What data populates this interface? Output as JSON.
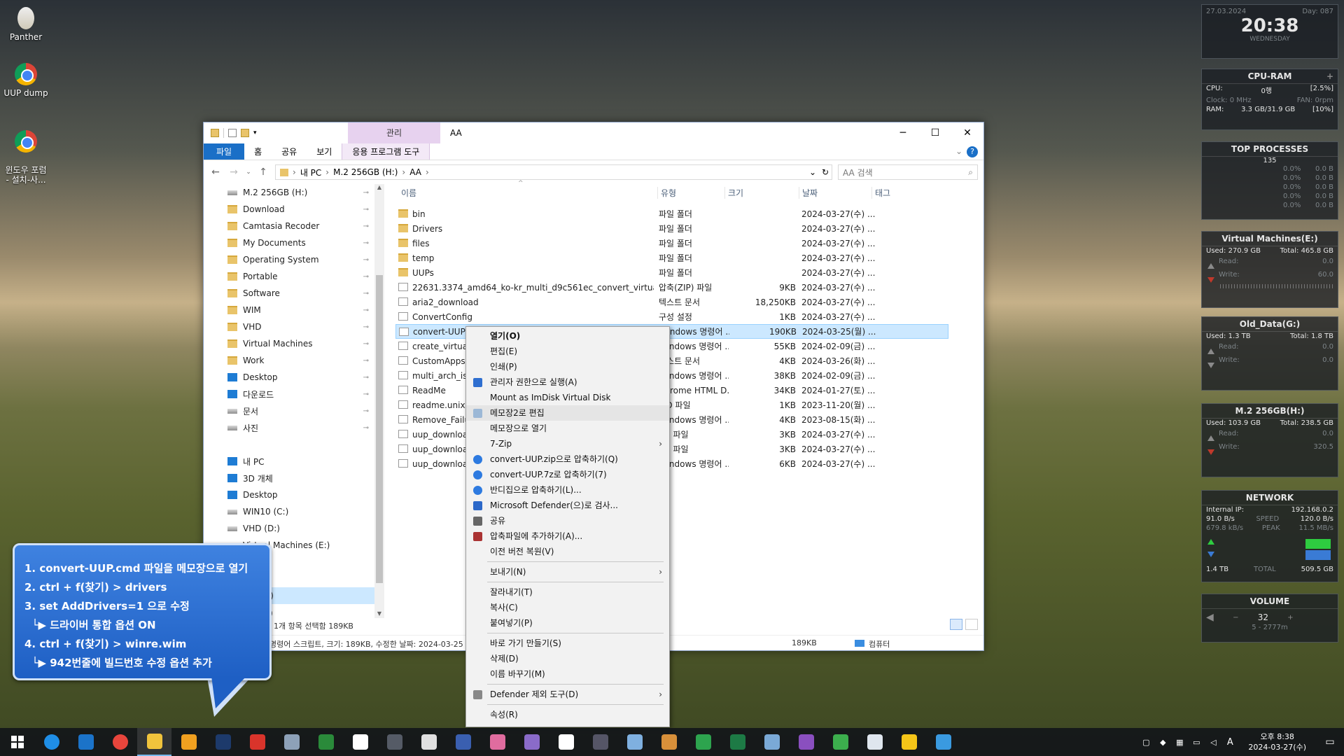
{
  "desktop": {
    "icons": [
      {
        "label": "Panther"
      },
      {
        "label": "UUP dump"
      },
      {
        "label": "윈도우 포럼\n- 설치-사..."
      }
    ]
  },
  "widgets": {
    "clock": {
      "date": "27.03.2024",
      "day": "Day: 087",
      "time": "20:38",
      "weekday": "WEDNESDAY"
    },
    "cpuram": {
      "title": "CPU-RAM",
      "cpu_label": "CPU:",
      "cpu_val": "0행",
      "cpu_pct": "[2.5%]",
      "clock": "Clock: 0 MHz",
      "fan": "FAN: 0rpm",
      "ram_label": "RAM:",
      "ram_val": "3.3 GB/31.9 GB",
      "ram_pct": "[10%]"
    },
    "top": {
      "title": "TOP PROCESSES",
      "count": "135",
      "rows": [
        "0.0%",
        "0.0%",
        "0.0%",
        "0.0%",
        "0.0%"
      ],
      "rows2": [
        "0.0 B",
        "0.0 B",
        "0.0 B",
        "0.0 B",
        "0.0 B"
      ]
    },
    "vm": {
      "title": "Virtual Machines(E:)",
      "used": "Used: 270.9 GB",
      "total": "Total: 465.8 GB",
      "read": "Read:",
      "write": "Write:",
      "rv": "0.0",
      "wv": "60.0"
    },
    "old": {
      "title": "Old_Data(G:)",
      "used": "Used: 1.3 TB",
      "total": "Total: 1.8 TB",
      "read": "Read:",
      "write": "Write:",
      "rv": "0.0",
      "wv": "0.0"
    },
    "m2": {
      "title": "M.2 256GB(H:)",
      "used": "Used: 103.9 GB",
      "total": "Total: 238.5 GB",
      "read": "Read:",
      "write": "Write:",
      "rv": "0.0",
      "wv": "320.5"
    },
    "net": {
      "title": "NETWORK",
      "ip_label": "Internal IP:",
      "ip": "192.168.0.2",
      "down": "91.0 B/s",
      "speed": "SPEED",
      "up": "120.0 B/s",
      "down2": "679.8 kB/s",
      "peak": "PEAK",
      "up2": "11.5 MB/s",
      "tot1": "1.4 TB",
      "total": "TOTAL",
      "tot2": "509.5 GB"
    },
    "volume": {
      "title": "VOLUME",
      "value": "32",
      "range": "5 - 2777m"
    }
  },
  "explorer": {
    "mgmt_tab": "관리",
    "title": "AA",
    "ribbon": [
      "파일",
      "홈",
      "공유",
      "보기",
      "응용 프로그램 도구"
    ],
    "breadcrumb": [
      "내 PC",
      "M.2 256GB (H:)",
      "AA"
    ],
    "search_placeholder": "AA 검색",
    "nav": [
      {
        "label": "M.2 256GB (H:)",
        "icon": "drive",
        "pin": true
      },
      {
        "label": "Download",
        "icon": "folder",
        "pin": true
      },
      {
        "label": "Camtasia Recoder",
        "icon": "folder",
        "pin": true
      },
      {
        "label": "My Documents",
        "icon": "folder",
        "pin": true
      },
      {
        "label": "Operating System",
        "icon": "folder",
        "pin": true
      },
      {
        "label": "Portable",
        "icon": "folder",
        "pin": true
      },
      {
        "label": "Software",
        "icon": "folder",
        "pin": true
      },
      {
        "label": "WIM",
        "icon": "folder",
        "pin": true
      },
      {
        "label": "VHD",
        "icon": "folder",
        "pin": true
      },
      {
        "label": "Virtual Machines",
        "icon": "folder",
        "pin": true
      },
      {
        "label": "Work",
        "icon": "folder",
        "pin": true
      },
      {
        "label": "Desktop",
        "icon": "blue",
        "pin": true
      },
      {
        "label": "다운로드",
        "icon": "blue",
        "pin": true
      },
      {
        "label": "문서",
        "icon": "drive",
        "pin": true
      },
      {
        "label": "사진",
        "icon": "drive",
        "pin": true
      },
      {
        "label": "",
        "icon": "",
        "pin": false
      },
      {
        "label": "내 PC",
        "icon": "blue",
        "pin": false
      },
      {
        "label": "3D 개체",
        "icon": "blue",
        "pin": false
      },
      {
        "label": "Desktop",
        "icon": "blue",
        "pin": false
      },
      {
        "label": "WIN10 (C:)",
        "icon": "drive",
        "pin": false
      },
      {
        "label": "VHD (D:)",
        "icon": "drive",
        "pin": false
      },
      {
        "label": "Virtual Machines (E:)",
        "icon": "drive",
        "pin": false
      },
      {
        "label": "ta (F:)",
        "icon": "drive",
        "pin": false
      },
      {
        "label": "a (G:)",
        "icon": "drive",
        "pin": false
      },
      {
        "label": "GB (H:)",
        "icon": "drive",
        "pin": false,
        "sel": true
      },
      {
        "label": "이브 (I:)",
        "icon": "drive",
        "pin": false
      }
    ],
    "columns": {
      "name": "이름",
      "type": "유형",
      "size": "크기",
      "date": "날짜",
      "tag": "태그"
    },
    "files": [
      {
        "name": "bin",
        "type": "파일 폴더",
        "size": "",
        "date": "2024-03-27(수) ...",
        "icon": "folder"
      },
      {
        "name": "Drivers",
        "type": "파일 폴더",
        "size": "",
        "date": "2024-03-27(수) ...",
        "icon": "folder"
      },
      {
        "name": "files",
        "type": "파일 폴더",
        "size": "",
        "date": "2024-03-27(수) ...",
        "icon": "folder"
      },
      {
        "name": "temp",
        "type": "파일 폴더",
        "size": "",
        "date": "2024-03-27(수) ...",
        "icon": "folder"
      },
      {
        "name": "UUPs",
        "type": "파일 폴더",
        "size": "",
        "date": "2024-03-27(수) ...",
        "icon": "folder"
      },
      {
        "name": "22631.3374_amd64_ko-kr_multi_d9c561ec_convert_virtual",
        "type": "압축(ZIP) 파일",
        "size": "9KB",
        "date": "2024-03-27(수) ...",
        "icon": "file"
      },
      {
        "name": "aria2_download",
        "type": "텍스트 문서",
        "size": "18,250KB",
        "date": "2024-03-27(수) ...",
        "icon": "file"
      },
      {
        "name": "ConvertConfig",
        "type": "구성 설정",
        "size": "1KB",
        "date": "2024-03-27(수) ...",
        "icon": "file"
      },
      {
        "name": "convert-UUP",
        "type": "Windows 명령어 ...",
        "size": "190KB",
        "date": "2024-03-25(월) ...",
        "icon": "file",
        "sel": true
      },
      {
        "name": "create_virtual_",
        "type": "Windows 명령어 ...",
        "size": "55KB",
        "date": "2024-02-09(금) ...",
        "icon": "file"
      },
      {
        "name": "CustomAppsL",
        "type": "텍스트 문서",
        "size": "4KB",
        "date": "2024-03-26(화) ...",
        "icon": "file"
      },
      {
        "name": "multi_arch_isc",
        "type": "Windows 명령어 ...",
        "size": "38KB",
        "date": "2024-02-09(금) ...",
        "icon": "file"
      },
      {
        "name": "ReadMe",
        "type": "Chrome HTML D...",
        "size": "34KB",
        "date": "2024-01-27(토) ...",
        "icon": "file"
      },
      {
        "name": "readme.unix.m",
        "type": "MD 파일",
        "size": "1KB",
        "date": "2023-11-20(월) ...",
        "icon": "file"
      },
      {
        "name": "Remove_Failu",
        "type": "Windows 명령어 ...",
        "size": "4KB",
        "date": "2023-08-15(화) ...",
        "icon": "file"
      },
      {
        "name": "uup_downloa",
        "type": "SH 파일",
        "size": "3KB",
        "date": "2024-03-27(수) ...",
        "icon": "file"
      },
      {
        "name": "uup_downloa",
        "type": "SH 파일",
        "size": "3KB",
        "date": "2024-03-27(수) ...",
        "icon": "file"
      },
      {
        "name": "uup_downloa",
        "type": "Windows 명령어 ...",
        "size": "6KB",
        "date": "2024-03-27(수) ...",
        "icon": "file"
      }
    ],
    "status_left": "1개 항목 선택함 189KB",
    "status_bottom": "명령어 스크립트, 크기: 189KB, 수정한 날짜: 2024-03-25",
    "status_size": "189KB",
    "status_pc": "컴퓨터"
  },
  "context_menu": [
    {
      "label": "열기(O)",
      "bold": true,
      "icon": ""
    },
    {
      "label": "편집(E)",
      "icon": ""
    },
    {
      "label": "인쇄(P)",
      "icon": ""
    },
    {
      "label": "관리자 권한으로 실행(A)",
      "icon": "shield"
    },
    {
      "label": "Mount as ImDisk Virtual Disk",
      "icon": ""
    },
    {
      "label": "메모장2로 편집",
      "icon": "notepad",
      "hl": true
    },
    {
      "label": "메모장으로 열기",
      "icon": ""
    },
    {
      "label": "7-Zip",
      "icon": "",
      "sub": true
    },
    {
      "label": "convert-UUP.zip으로 압축하기(Q)",
      "icon": "bandizip"
    },
    {
      "label": "convert-UUP.7z로 압축하기(7)",
      "icon": "bandizip"
    },
    {
      "label": "반디집으로 압축하기(L)...",
      "icon": "bandizip"
    },
    {
      "label": "Microsoft Defender(으)로 검사...",
      "icon": "defender"
    },
    {
      "label": "공유",
      "icon": "share"
    },
    {
      "label": "압축파일에 추가하기(A)...",
      "icon": "winrar"
    },
    {
      "label": "이전 버전 복원(V)",
      "icon": ""
    },
    {
      "sep": true
    },
    {
      "label": "보내기(N)",
      "icon": "",
      "sub": true
    },
    {
      "sep": true
    },
    {
      "label": "잘라내기(T)",
      "icon": ""
    },
    {
      "label": "복사(C)",
      "icon": ""
    },
    {
      "label": "붙여넣기(P)",
      "icon": ""
    },
    {
      "sep": true
    },
    {
      "label": "바로 가기 만들기(S)",
      "icon": ""
    },
    {
      "label": "삭제(D)",
      "icon": ""
    },
    {
      "label": "이름 바꾸기(M)",
      "icon": ""
    },
    {
      "sep": true
    },
    {
      "label": "Defender 제외 도구(D)",
      "icon": "gear",
      "sub": true
    },
    {
      "sep": true
    },
    {
      "label": "속성(R)",
      "icon": ""
    }
  ],
  "callout": [
    "1. convert-UUP.cmd 파일을 메모장으로 열기",
    "2. ctrl + f(찾기) > drivers",
    "3. set AddDrivers=1 으로 수정",
    "  └▶ 드라이버 통합 옵션 ON",
    "4. ctrl + f(찾기) > winre.wim",
    "  └▶ 942번줄에 빌드번호 수정 옵션 추가"
  ],
  "taskbar": {
    "apps": [
      "edge",
      "ie",
      "chrome",
      "explorer",
      "app5",
      "photoshop",
      "app7",
      "app8",
      "app9",
      "notepad",
      "app11",
      "app12",
      "app13",
      "app14",
      "app15",
      "app16",
      "app17",
      "app18",
      "app19",
      "app20",
      "excel",
      "app22",
      "app23",
      "app24",
      "app25",
      "app26",
      "app27"
    ],
    "time": "오후 8:38",
    "date": "2024-03-27(수)",
    "ime": "A"
  }
}
